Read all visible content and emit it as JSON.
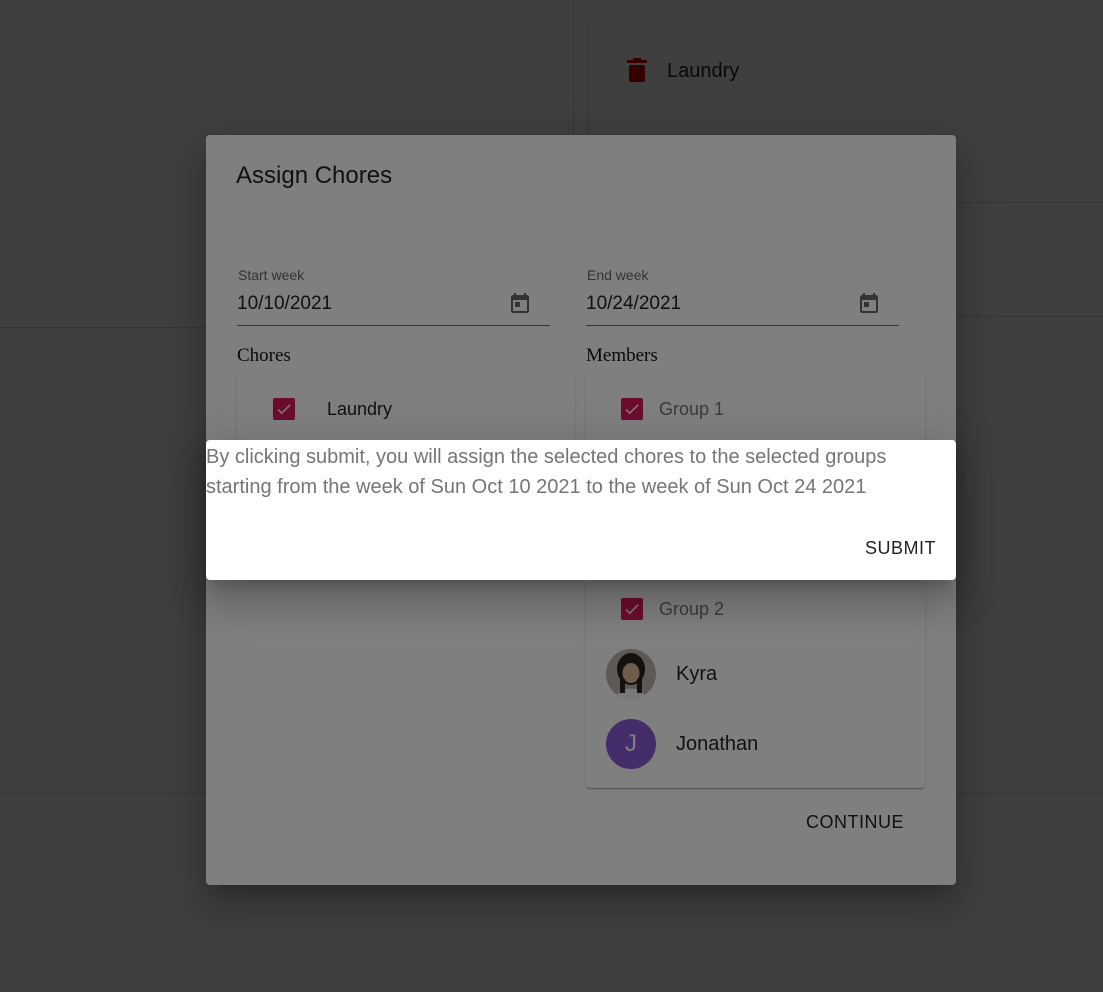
{
  "background": {
    "chore_item": "Laundry"
  },
  "dialog": {
    "title": "Assign Chores",
    "start_week": {
      "label": "Start week",
      "value": "10/10/2021"
    },
    "end_week": {
      "label": "End week",
      "value": "10/24/2021"
    },
    "chores_heading": "Chores",
    "members_heading": "Members",
    "chores": [
      {
        "label": "Laundry",
        "checked": true
      }
    ],
    "groups": [
      {
        "label": "Group 1",
        "checked": true
      },
      {
        "label": "Group 2",
        "checked": true
      }
    ],
    "members": [
      {
        "name": "Kyra"
      },
      {
        "name": "Jonathan",
        "initial": "J",
        "color": "#8a58d4"
      }
    ],
    "continue_label": "CONTINUE"
  },
  "confirm": {
    "message": "By clicking submit, you will assign the selected chores to the selected groups starting from the week of Sun Oct 10 2021 to the week of Sun Oct 24 2021",
    "submit_label": "SUBMIT"
  },
  "colors": {
    "checkbox": "#d81b60",
    "trash_icon": "#d50000"
  }
}
